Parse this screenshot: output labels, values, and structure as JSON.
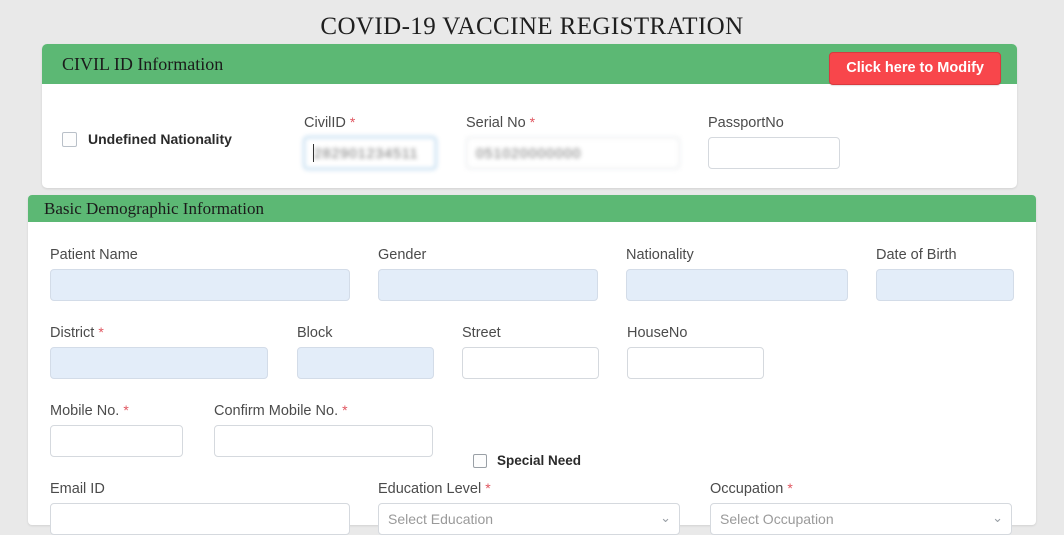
{
  "page": {
    "title": "COVID-19 VACCINE REGISTRATION"
  },
  "civil_id_section": {
    "heading": "CIVIL ID Information",
    "modify_button": "Click here to Modify",
    "undefined_nationality": {
      "label": "Undefined Nationality",
      "checked": false
    },
    "fields": {
      "civil_id": {
        "label": "CivilID",
        "required": "*",
        "value": "282901234511",
        "redacted": true,
        "focused": true,
        "placeholder": ""
      },
      "serial_no": {
        "label": "Serial No",
        "required": "*",
        "value": "051020000000",
        "redacted": true,
        "focused": false,
        "placeholder": ""
      },
      "passport_no": {
        "label": "PassportNo",
        "required": "",
        "value": "",
        "redacted": false,
        "focused": false,
        "placeholder": ""
      }
    }
  },
  "demographic_section": {
    "heading": "Basic Demographic Information",
    "fields": {
      "patient_name": {
        "label": "Patient Name",
        "required": "",
        "value": "",
        "readonly": true
      },
      "gender": {
        "label": "Gender",
        "required": "",
        "value": "",
        "readonly": true
      },
      "nationality": {
        "label": "Nationality",
        "required": "",
        "value": "",
        "readonly": true
      },
      "date_of_birth": {
        "label": "Date of Birth",
        "required": "",
        "value": "",
        "readonly": true
      },
      "district": {
        "label": "District",
        "required": "*",
        "value": "",
        "readonly": true
      },
      "block": {
        "label": "Block",
        "required": "",
        "value": "",
        "readonly": true
      },
      "street": {
        "label": "Street",
        "required": "",
        "value": "",
        "readonly": false
      },
      "house_no": {
        "label": "HouseNo",
        "required": "",
        "value": "",
        "readonly": false
      },
      "mobile_no": {
        "label": "Mobile No.",
        "required": "*",
        "value": "",
        "readonly": false
      },
      "confirm_mobile_no": {
        "label": "Confirm Mobile No.",
        "required": "*",
        "value": "",
        "readonly": false
      },
      "email_id": {
        "label": "Email ID",
        "required": "",
        "value": "",
        "readonly": false
      },
      "education_level": {
        "label": "Education Level",
        "required": "*",
        "selected": "Select Education",
        "chevron": "chevron-down-icon"
      },
      "occupation": {
        "label": "Occupation",
        "required": "*",
        "selected": "Select Occupation",
        "chevron": "chevron-down-icon"
      }
    },
    "special_need": {
      "label": "Special Need",
      "checked": false
    }
  },
  "colors": {
    "page_background": "#e9e9e9",
    "panel_header_green": "#5cb874",
    "modify_button_red": "#f8464b",
    "readonly_field_blue": "#e3edf9",
    "required_asterisk": "#e0555f",
    "focus_border": "#7eb6e0"
  }
}
